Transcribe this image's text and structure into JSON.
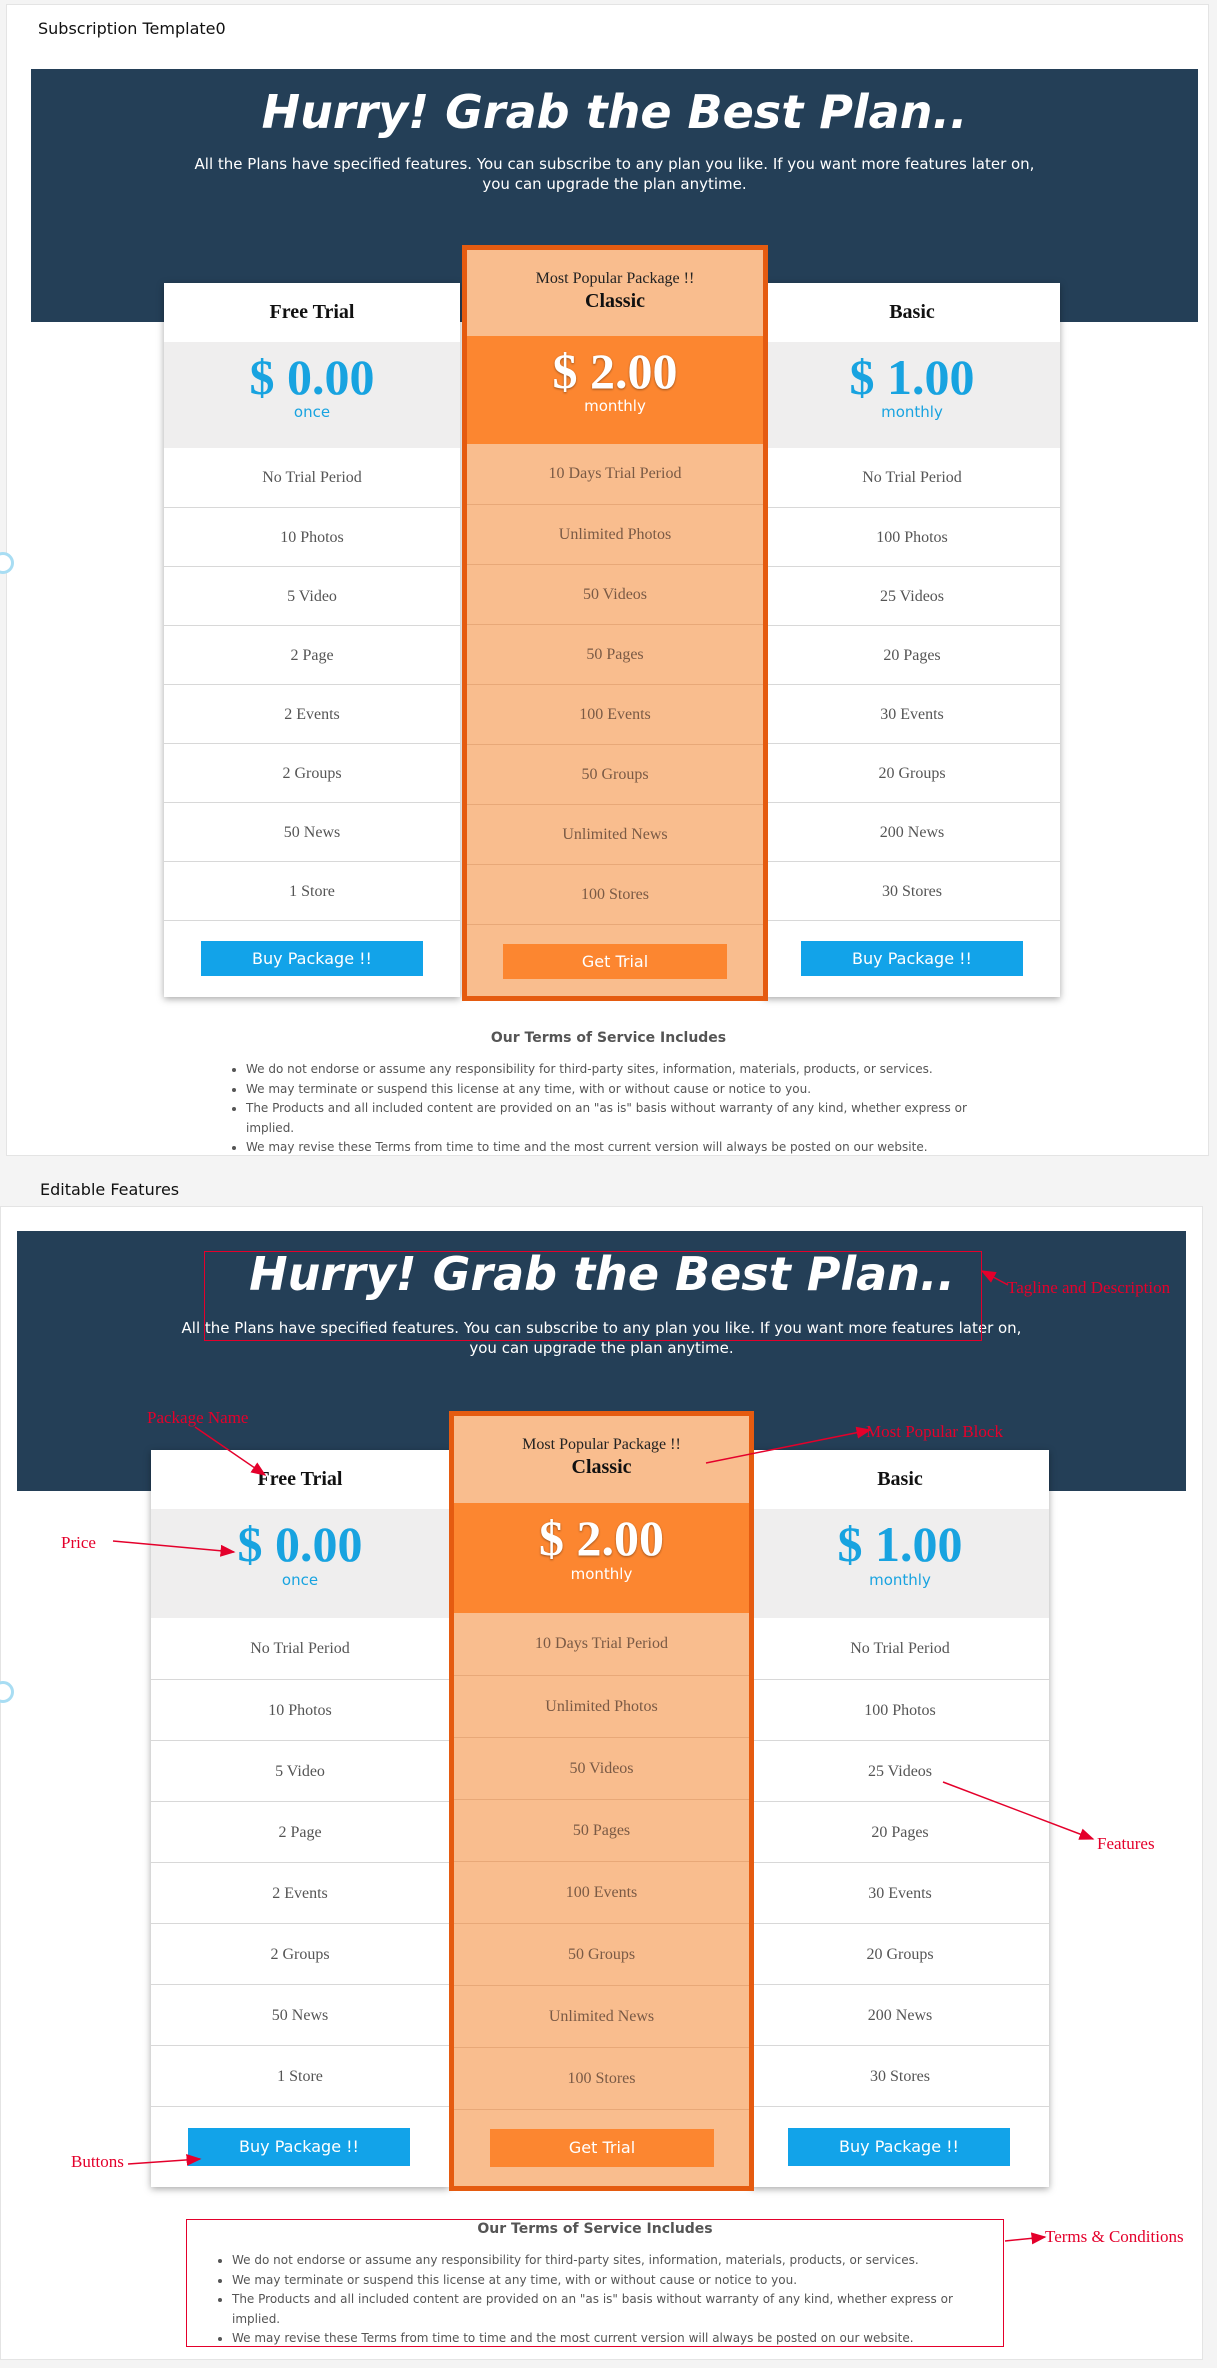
{
  "sections": {
    "template_label": "Subscription Template0",
    "editable_label": "Editable Features"
  },
  "header": {
    "title": "Hurry! Grab the Best Plan..",
    "desc_line1": "All the Plans have specified features. You can subscribe to any plan you like. If you want more features later on,",
    "desc_line2": "you can upgrade the plan anytime."
  },
  "plans": [
    {
      "name": "Free Trial",
      "price": "$ 0.00",
      "period": "once",
      "features": [
        "No Trial Period",
        "10 Photos",
        "5 Video",
        "2 Page",
        "2 Events",
        "2 Groups",
        "50 News",
        "1 Store"
      ],
      "button": "Buy Package !!"
    },
    {
      "tag": "Most Popular Package !!",
      "name": "Classic",
      "price": "$ 2.00",
      "period": "monthly",
      "features": [
        "10 Days Trial Period",
        "Unlimited Photos",
        "50 Videos",
        "50 Pages",
        "100 Events",
        "50 Groups",
        "Unlimited News",
        "100 Stores"
      ],
      "button": "Get Trial"
    },
    {
      "name": "Basic",
      "price": "$ 1.00",
      "period": "monthly",
      "features": [
        "No Trial Period",
        "100 Photos",
        "25 Videos",
        "20 Pages",
        "30 Events",
        "20 Groups",
        "200 News",
        "30 Stores"
      ],
      "button": "Buy Package !!"
    }
  ],
  "terms": {
    "title": "Our Terms of Service Includes",
    "items": [
      "We do not endorse or assume any responsibility for third-party sites, information, materials, products, or services.",
      "We may terminate or suspend this license at any time, with or without cause or notice to you.",
      "The Products and all included content are provided on an \"as is\" basis without warranty of any kind, whether express or implied.",
      "We may revise these Terms from time to time and the most current version will always be posted on our website."
    ]
  },
  "annotations": {
    "tagline": "Tagline and Description",
    "package_name": "Package Name",
    "most_popular": "Most Popular Block",
    "price": "Price",
    "features": "Features",
    "buttons": "Buttons",
    "terms": "Terms & Conditions"
  },
  "colors": {
    "banner": "#243f57",
    "accent_blue": "#12a3e9",
    "popular_orange": "#fc8630",
    "popular_border": "#e55b10",
    "popular_bg": "#f9bd8e",
    "annotation_red": "#e4002b"
  }
}
